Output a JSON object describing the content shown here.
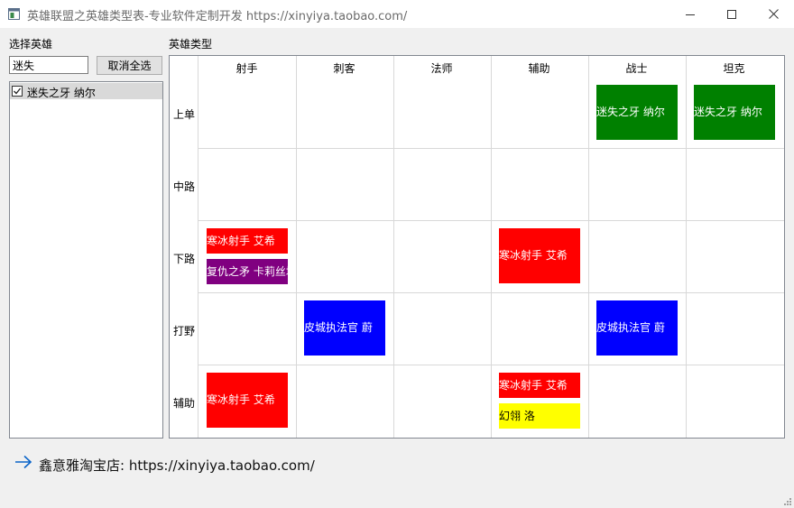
{
  "window": {
    "title": "英雄联盟之英雄类型表-专业软件定制开发 https://xinyiya.taobao.com/"
  },
  "left_panel": {
    "label": "选择英雄",
    "search_value": "迷失",
    "clear_button": "取消全选",
    "hero_list": [
      {
        "name": "迷失之牙 纳尔",
        "checked": true
      }
    ]
  },
  "right_panel": {
    "label": "英雄类型"
  },
  "grid": {
    "columns": [
      "射手",
      "刺客",
      "法师",
      "辅助",
      "战士",
      "坦克"
    ],
    "rows": [
      "上单",
      "中路",
      "下路",
      "打野",
      "辅助"
    ],
    "cells": [
      {
        "row": 0,
        "col": 4,
        "heroes": [
          {
            "name": "迷失之牙 纳尔",
            "color": "#008000",
            "text_color": "#ffffff"
          }
        ]
      },
      {
        "row": 0,
        "col": 5,
        "heroes": [
          {
            "name": "迷失之牙 纳尔",
            "color": "#008000",
            "text_color": "#ffffff"
          }
        ]
      },
      {
        "row": 2,
        "col": 0,
        "heroes": [
          {
            "name": "寒冰射手 艾希",
            "color": "#ff0000",
            "text_color": "#ffffff"
          },
          {
            "name": "复仇之矛 卡莉丝塔",
            "color": "#800080",
            "text_color": "#ffffff"
          }
        ]
      },
      {
        "row": 2,
        "col": 3,
        "heroes": [
          {
            "name": "寒冰射手 艾希",
            "color": "#ff0000",
            "text_color": "#ffffff"
          }
        ]
      },
      {
        "row": 3,
        "col": 1,
        "heroes": [
          {
            "name": "皮城执法官 蔚",
            "color": "#0000ff",
            "text_color": "#ffffff"
          }
        ]
      },
      {
        "row": 3,
        "col": 4,
        "heroes": [
          {
            "name": "皮城执法官 蔚",
            "color": "#0000ff",
            "text_color": "#ffffff"
          }
        ]
      },
      {
        "row": 4,
        "col": 0,
        "heroes": [
          {
            "name": "寒冰射手 艾希",
            "color": "#ff0000",
            "text_color": "#ffffff"
          }
        ]
      },
      {
        "row": 4,
        "col": 3,
        "heroes": [
          {
            "name": "寒冰射手 艾希",
            "color": "#ff0000",
            "text_color": "#ffffff"
          },
          {
            "name": "幻翎 洛",
            "color": "#ffff00",
            "text_color": "#000000"
          }
        ]
      }
    ]
  },
  "footer": {
    "text": "鑫意雅淘宝店: https://xinyiya.taobao.com/",
    "arrow_color": "#0a64c8"
  }
}
